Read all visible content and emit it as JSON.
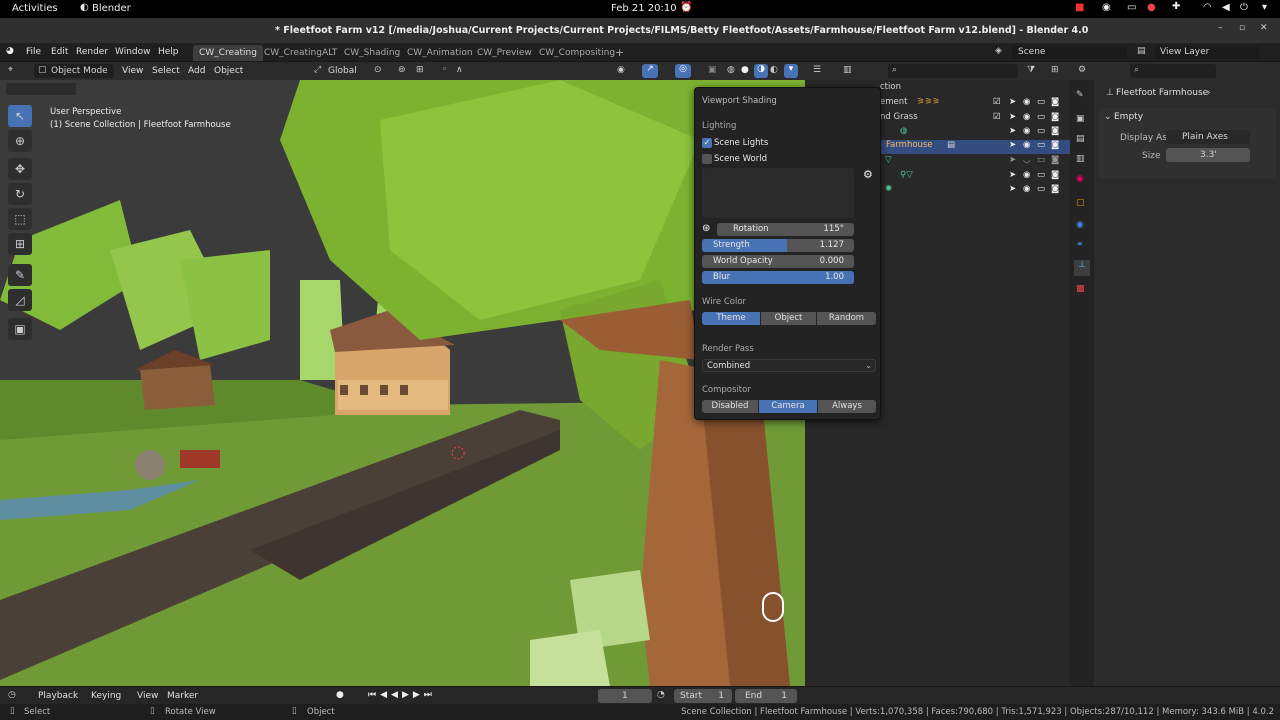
{
  "gnome": {
    "activities": "Activities",
    "app": "Blender",
    "clock": "Feb 21  20:10"
  },
  "window": {
    "title": "* Fleetfoot Farm v12 [/media/Joshua/Current Projects/Current Projects/FILMS/Betty Fleetfoot/Assets/Farmhouse/Fleetfoot Farm v12.blend] - Blender 4.0"
  },
  "menus": [
    "File",
    "Edit",
    "Render",
    "Window",
    "Help"
  ],
  "workspaces": [
    "CW_Creating",
    "CW_CreatingALT",
    "CW_Shading",
    "CW_Animation",
    "CW_Preview",
    "CW_Compositing"
  ],
  "scene": {
    "label": "Scene",
    "view_layer": "View Layer"
  },
  "viewport": {
    "mode": "Object Mode",
    "menu": [
      "View",
      "Select",
      "Add",
      "Object"
    ],
    "orientation": "Global",
    "overlay_line1": "User Perspective",
    "overlay_line2": "(1) Scene Collection | Fleetfoot Farmhouse"
  },
  "shading_popover": {
    "title": "Viewport Shading",
    "lighting": "Lighting",
    "scene_lights": "Scene Lights",
    "scene_world": "Scene World",
    "rotation_label": "Rotation",
    "rotation_value": "115°",
    "rotation_fraction": 0.0,
    "strength_label": "Strength",
    "strength_value": "1.127",
    "strength_fraction": 0.56,
    "opacity_label": "World Opacity",
    "opacity_value": "0.000",
    "opacity_fraction": 0.0,
    "blur_label": "Blur",
    "blur_value": "1.00",
    "blur_fraction": 1.0,
    "wire_color": "Wire Color",
    "wire_options": [
      "Theme",
      "Object",
      "Random"
    ],
    "render_pass": "Render Pass",
    "render_pass_value": "Combined",
    "compositor": "Compositor",
    "compositor_options": [
      "Disabled",
      "Camera",
      "Always"
    ]
  },
  "outliner": {
    "rows": [
      "ction",
      "ement",
      "nd Grass",
      "",
      "Farmhouse",
      "",
      "",
      ""
    ]
  },
  "properties": {
    "object": "Fleetfoot Farmhouse",
    "panel": "Empty",
    "display_as_label": "Display As",
    "display_as_value": "Plain Axes",
    "size_label": "Size",
    "size_value": "3.3'"
  },
  "timeline": {
    "playback": "Playback",
    "keying": "Keying",
    "view": "View",
    "marker": "Marker",
    "frame": "1",
    "start_label": "Start",
    "start": "1",
    "end_label": "End",
    "end": "1"
  },
  "status": {
    "select": "Select",
    "rotate": "Rotate View",
    "object": "Object",
    "stats": "Scene Collection | Fleetfoot Farmhouse | Verts:1,070,358 | Faces:790,680 | Tris:1,571,923 | Objects:287/10,112 | Memory: 343.6 MiB | 4.0.2"
  },
  "colors": {
    "accent": "#4772b3",
    "grass": "#6f9a36",
    "tree": "#7cb230"
  }
}
